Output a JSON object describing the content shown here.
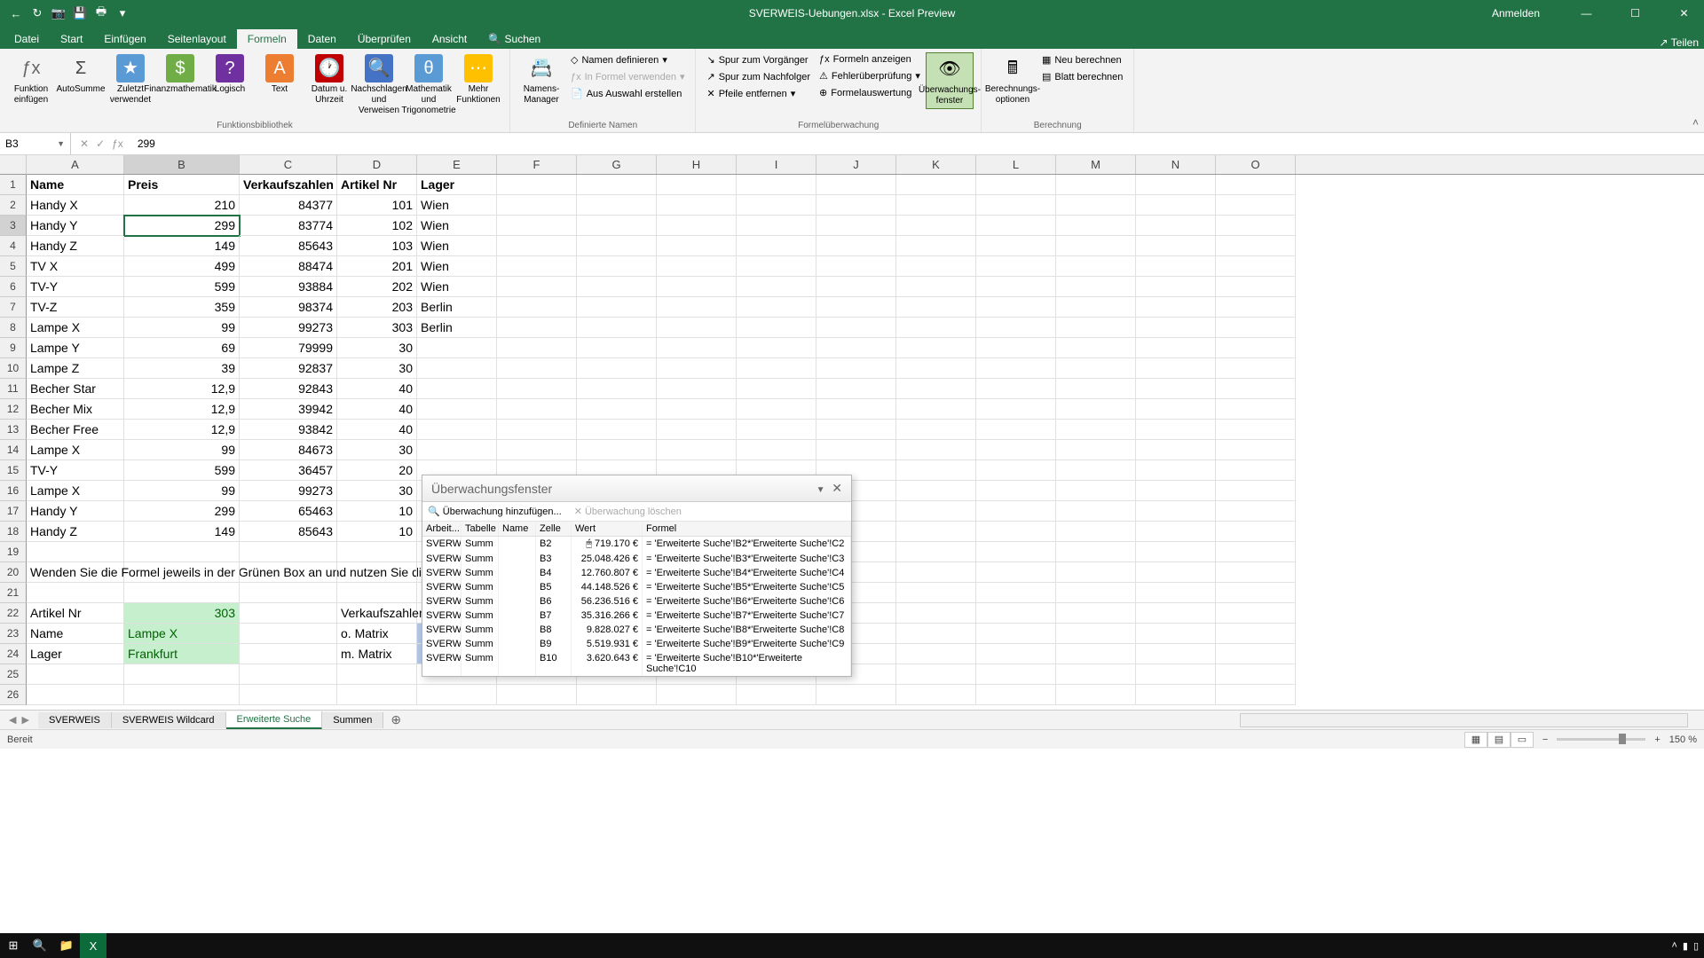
{
  "app": {
    "title": "SVERWEIS-Uebungen.xlsx - Excel Preview",
    "signin": "Anmelden"
  },
  "menu": {
    "tabs": [
      "Datei",
      "Start",
      "Einfügen",
      "Seitenlayout",
      "Formeln",
      "Daten",
      "Überprüfen",
      "Ansicht"
    ],
    "active": "Formeln",
    "search_icon": "🔍",
    "search": "Suchen",
    "share": "Teilen"
  },
  "ribbon": {
    "groups": {
      "func_lib": "Funktionsbibliothek",
      "def_names": "Definierte Namen",
      "audit": "Formelüberwachung",
      "calc": "Berechnung"
    },
    "btns": {
      "fx": "Funktion einfügen",
      "autosum": "AutoSumme",
      "recent": "Zuletzt verwendet",
      "financial": "Finanzmathematik",
      "logical": "Logisch",
      "text": "Text",
      "datetime": "Datum u. Uhrzeit",
      "lookup": "Nachschlagen und Verweisen",
      "math": "Mathematik und Trigonometrie",
      "more": "Mehr Funktionen",
      "name_mgr": "Namens-Manager",
      "def_name": "Namen definieren",
      "use_formula": "In Formel verwenden",
      "from_sel": "Aus Auswahl erstellen",
      "trace_prec": "Spur zum Vorgänger",
      "trace_dep": "Spur zum Nachfolger",
      "remove_arrows": "Pfeile entfernen",
      "show_formulas": "Formeln anzeigen",
      "error_check": "Fehlerüberprüfung",
      "eval_formula": "Formelauswertung",
      "watch": "Überwachungs-fenster",
      "calc_opts": "Berechnungs-optionen",
      "calc_now": "Neu berechnen",
      "calc_sheet": "Blatt berechnen"
    }
  },
  "formula_bar": {
    "cell_ref": "B3",
    "value": "299"
  },
  "columns": [
    "A",
    "B",
    "C",
    "D",
    "E",
    "F",
    "G",
    "H",
    "I",
    "J",
    "K",
    "L",
    "M",
    "N",
    "O"
  ],
  "headers": {
    "A": "Name",
    "B": "Preis",
    "C": "Verkaufszahlen",
    "D": "Artikel Nr",
    "E": "Lager"
  },
  "rows": [
    {
      "A": "Handy X",
      "B": "210",
      "C": "84377",
      "D": "101",
      "E": "Wien"
    },
    {
      "A": "Handy Y",
      "B": "299",
      "C": "83774",
      "D": "102",
      "E": "Wien"
    },
    {
      "A": "Handy Z",
      "B": "149",
      "C": "85643",
      "D": "103",
      "E": "Wien"
    },
    {
      "A": "TV X",
      "B": "499",
      "C": "88474",
      "D": "201",
      "E": "Wien"
    },
    {
      "A": "TV-Y",
      "B": "599",
      "C": "93884",
      "D": "202",
      "E": "Wien"
    },
    {
      "A": "TV-Z",
      "B": "359",
      "C": "98374",
      "D": "203",
      "E": "Berlin"
    },
    {
      "A": "Lampe X",
      "B": "99",
      "C": "99273",
      "D": "303",
      "E": "Berlin"
    },
    {
      "A": "Lampe Y",
      "B": "69",
      "C": "79999",
      "D": "30",
      "E": ""
    },
    {
      "A": "Lampe Z",
      "B": "39",
      "C": "92837",
      "D": "30",
      "E": ""
    },
    {
      "A": "Becher Star",
      "B": "12,9",
      "C": "92843",
      "D": "40",
      "E": ""
    },
    {
      "A": "Becher Mix",
      "B": "12,9",
      "C": "39942",
      "D": "40",
      "E": ""
    },
    {
      "A": "Becher Free",
      "B": "12,9",
      "C": "93842",
      "D": "40",
      "E": ""
    },
    {
      "A": "Lampe X",
      "B": "99",
      "C": "84673",
      "D": "30",
      "E": ""
    },
    {
      "A": "TV-Y",
      "B": "599",
      "C": "36457",
      "D": "20",
      "E": ""
    },
    {
      "A": "Lampe X",
      "B": "99",
      "C": "99273",
      "D": "30",
      "E": ""
    },
    {
      "A": "Handy Y",
      "B": "299",
      "C": "65463",
      "D": "10",
      "E": ""
    },
    {
      "A": "Handy Z",
      "B": "149",
      "C": "85643",
      "D": "10",
      "E": ""
    }
  ],
  "instruction": "Wenden Sie die Formel jeweils in der Grünen Box an und nutzen Sie die Blaue als Suchkriterium",
  "lookup": {
    "r22": {
      "A": "Artikel Nr",
      "B": "303",
      "D": "Verkaufszahlen"
    },
    "r23": {
      "A": "Name",
      "B": "Lampe X",
      "D": "o. Matrix"
    },
    "r24": {
      "A": "Lager",
      "B": "Frankfurt",
      "D": "m. Matrix"
    }
  },
  "watch": {
    "title": "Überwachungsfenster",
    "add": "Überwachung hinzufügen...",
    "del": "Überwachung löschen",
    "headers": [
      "Arbeit...",
      "Tabelle",
      "Name",
      "Zelle",
      "Wert",
      "Formel"
    ],
    "rows": [
      {
        "a": "SVERW...",
        "t": "Summ",
        "n": "",
        "z": "B2",
        "w": "🖱 719.170 €",
        "f": "= 'Erweiterte Suche'!B2*'Erweiterte Suche'!C2"
      },
      {
        "a": "SVERW...",
        "t": "Summ",
        "n": "",
        "z": "B3",
        "w": "25.048.426 €",
        "f": "= 'Erweiterte Suche'!B3*'Erweiterte Suche'!C3"
      },
      {
        "a": "SVERW...",
        "t": "Summ",
        "n": "",
        "z": "B4",
        "w": "12.760.807 €",
        "f": "= 'Erweiterte Suche'!B4*'Erweiterte Suche'!C4"
      },
      {
        "a": "SVERW...",
        "t": "Summ",
        "n": "",
        "z": "B5",
        "w": "44.148.526 €",
        "f": "= 'Erweiterte Suche'!B5*'Erweiterte Suche'!C5"
      },
      {
        "a": "SVERW...",
        "t": "Summ",
        "n": "",
        "z": "B6",
        "w": "56.236.516 €",
        "f": "= 'Erweiterte Suche'!B6*'Erweiterte Suche'!C6"
      },
      {
        "a": "SVERW...",
        "t": "Summ",
        "n": "",
        "z": "B7",
        "w": "35.316.266 €",
        "f": "= 'Erweiterte Suche'!B7*'Erweiterte Suche'!C7"
      },
      {
        "a": "SVERW...",
        "t": "Summ",
        "n": "",
        "z": "B8",
        "w": "9.828.027 €",
        "f": "= 'Erweiterte Suche'!B8*'Erweiterte Suche'!C8"
      },
      {
        "a": "SVERW...",
        "t": "Summ",
        "n": "",
        "z": "B9",
        "w": "5.519.931 €",
        "f": "= 'Erweiterte Suche'!B9*'Erweiterte Suche'!C9"
      },
      {
        "a": "SVERW...",
        "t": "Summ",
        "n": "",
        "z": "B10",
        "w": "3.620.643 €",
        "f": "= 'Erweiterte Suche'!B10*'Erweiterte Suche'!C10"
      }
    ]
  },
  "sheets": {
    "tabs": [
      "SVERWEIS",
      "SVERWEIS Wildcard",
      "Erweiterte Suche",
      "Summen"
    ],
    "active": "Erweiterte Suche"
  },
  "status": {
    "ready": "Bereit",
    "zoom": "150 %"
  }
}
